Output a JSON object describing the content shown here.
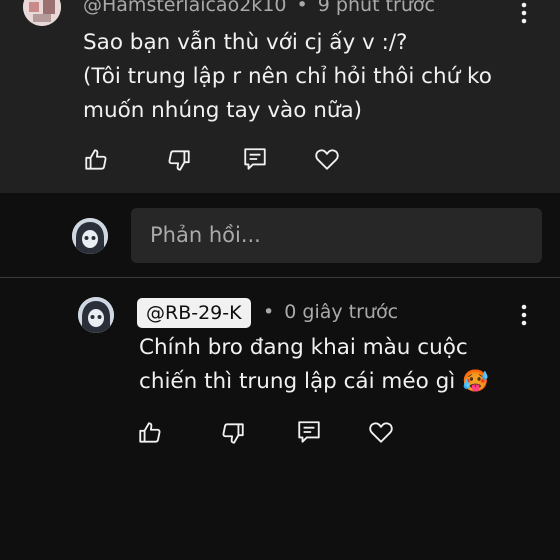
{
  "parent_comment": {
    "author": "@Hamsterlaicao2k10",
    "separator": "•",
    "time": "9 phút trước",
    "text": "Sao bạn vẫn thù với cj ấy v :/?\n(Tôi trung lập r nên chỉ hỏi thôi chứ ko\nmuốn nhúng tay vào nữa)",
    "actions": [
      "like-icon",
      "dislike-icon",
      "reply-icon",
      "heart-icon"
    ]
  },
  "reply_box": {
    "placeholder": "Phản hồi..."
  },
  "reply_comment": {
    "author": "@RB-29-K",
    "separator": "•",
    "time": "0 giây trước",
    "text": "Chính bro đang khai màu cuộc\nchiến thì trung lập cái méo gì",
    "emoji": "🥵",
    "actions": [
      "like-icon",
      "dislike-icon",
      "reply-icon",
      "heart-icon"
    ]
  },
  "colors": {
    "background": "#0f0f0f",
    "card_background": "#212121",
    "input_background": "#272727",
    "primary_text": "#f1f1f1",
    "secondary_text": "#aaaaaa"
  }
}
